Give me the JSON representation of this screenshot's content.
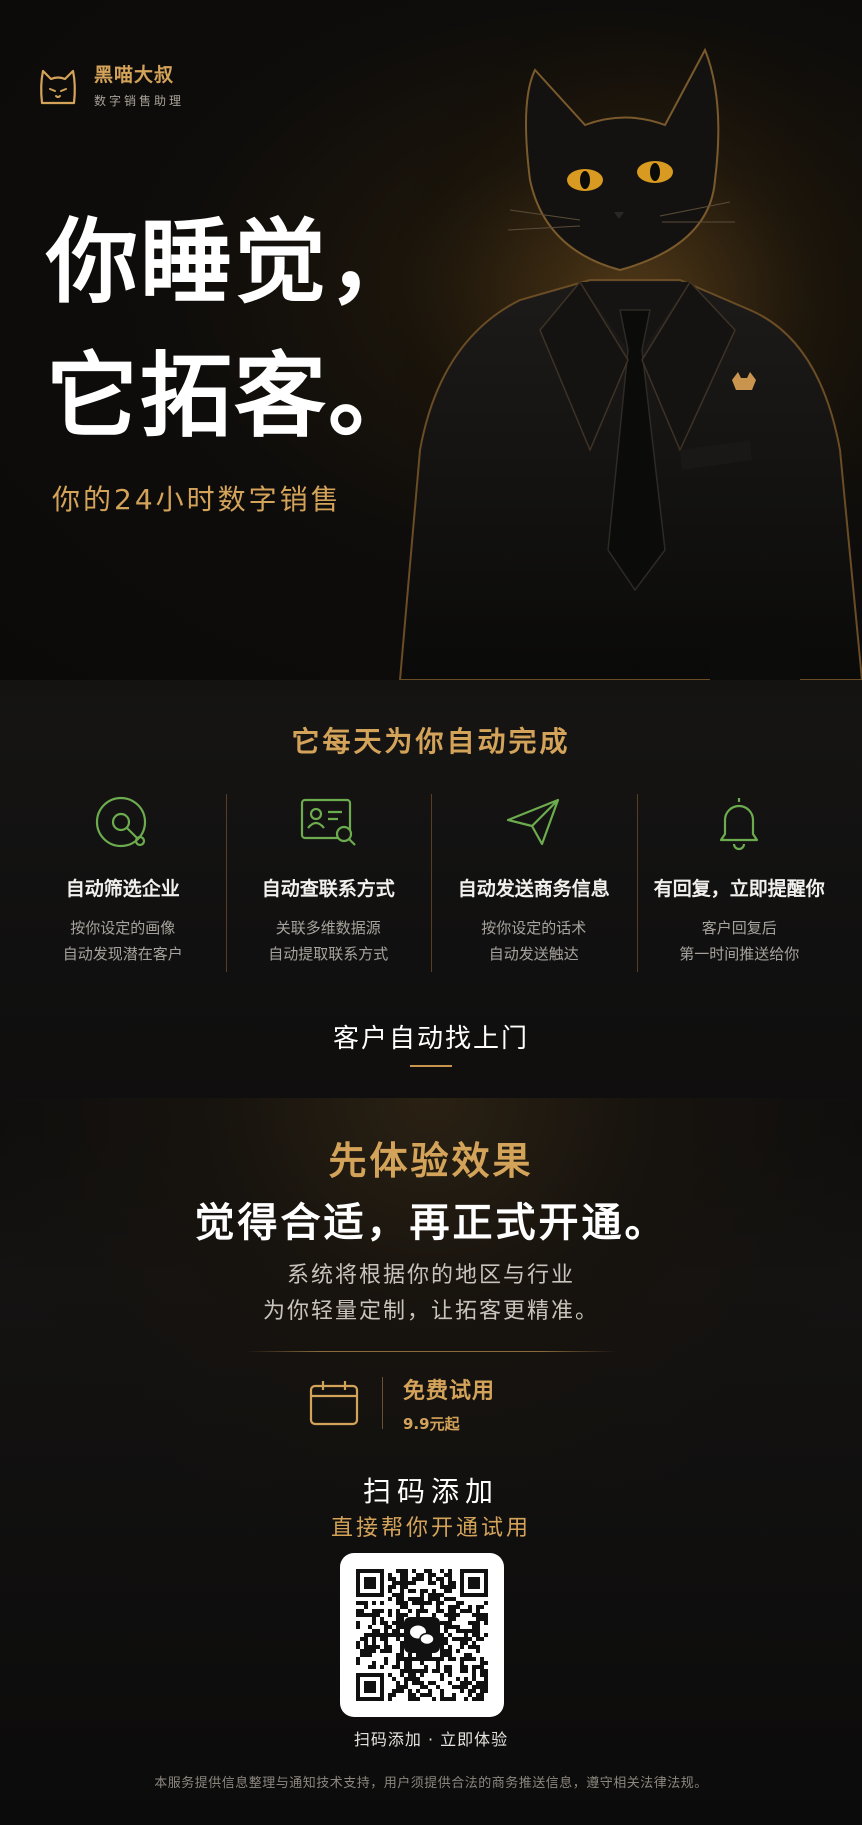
{
  "brand": {
    "name": "黑喵大叔",
    "subtitle": "数字销售助理"
  },
  "hero": {
    "headline_line1": "你睡觉，",
    "headline_line2": "它拓客。",
    "tagline": "你的24小时数字销售"
  },
  "features_section": {
    "title": "它每天为你自动完成",
    "items": [
      {
        "icon": "target-icon",
        "title": "自动筛选企业",
        "desc_line1": "按你设定的画像",
        "desc_line2": "自动发现潜在客户"
      },
      {
        "icon": "contact-card-search-icon",
        "title": "自动查联系方式",
        "desc_line1": "关联多维数据源",
        "desc_line2": "自动提取联系方式"
      },
      {
        "icon": "paper-plane-icon",
        "title": "自动发送商务信息",
        "desc_line1": "按你设定的话术",
        "desc_line2": "自动发送触达"
      },
      {
        "icon": "bell-icon",
        "title": "有回复，立即提醒你",
        "desc_line1": "客户回复后",
        "desc_line2": "第一时间推送给你"
      }
    ],
    "summary": "客户自动找上门"
  },
  "trial": {
    "title_gold": "先体验效果",
    "title_white": "觉得合适，再正式开通。",
    "desc_line1": "系统将根据你的地区与行业",
    "desc_line2": "为你轻量定制，让拓客更精准。",
    "offer_label": "免费试用",
    "offer_price": "9.9元起",
    "offer_icon": "calendar-icon",
    "scan_title": "扫码添加",
    "scan_subtitle": "直接帮你开通试用",
    "qr_caption": "扫码添加 · 立即体验"
  },
  "footer": {
    "disclaimer": "本服务提供信息整理与通知技术支持，用户须提供合法的商务推送信息，遵守相关法律法规。"
  },
  "colors": {
    "accent_gold": "#d4a35a",
    "icon_green": "#6cab4e",
    "background": "#0d0c0b"
  }
}
